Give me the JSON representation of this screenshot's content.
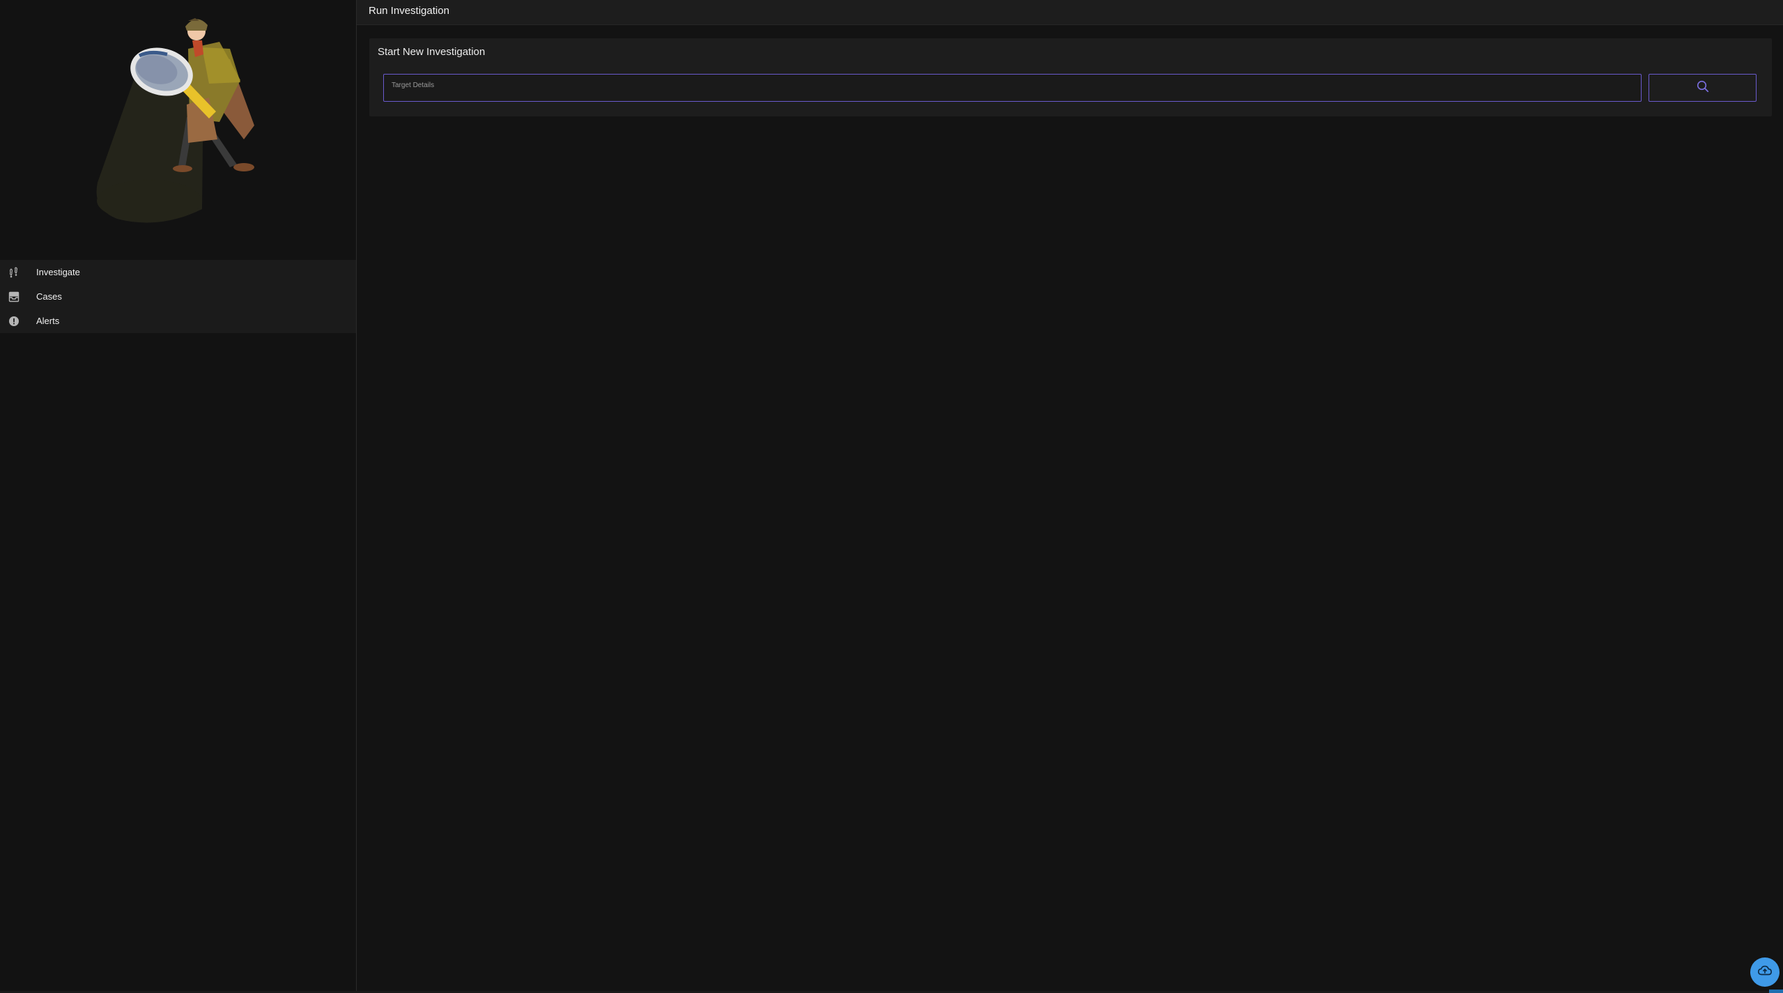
{
  "header": {
    "title": "Run Investigation"
  },
  "sidebar": {
    "logo_icon": "detective-magnifier-illustration",
    "items": [
      {
        "label": "Investigate",
        "icon": "footprints-icon"
      },
      {
        "label": "Cases",
        "icon": "inbox-tray-icon"
      },
      {
        "label": "Alerts",
        "icon": "alert-circle-icon"
      }
    ]
  },
  "main": {
    "card": {
      "title": "Start New Investigation",
      "target_placeholder": "Target Details",
      "search_icon": "search-icon"
    }
  },
  "fab": {
    "icon": "cloud-upload-icon"
  },
  "colors": {
    "accent": "#6a5acd",
    "fab": "#3f9ae8",
    "background": "#131313",
    "panel": "#1d1d1d"
  }
}
